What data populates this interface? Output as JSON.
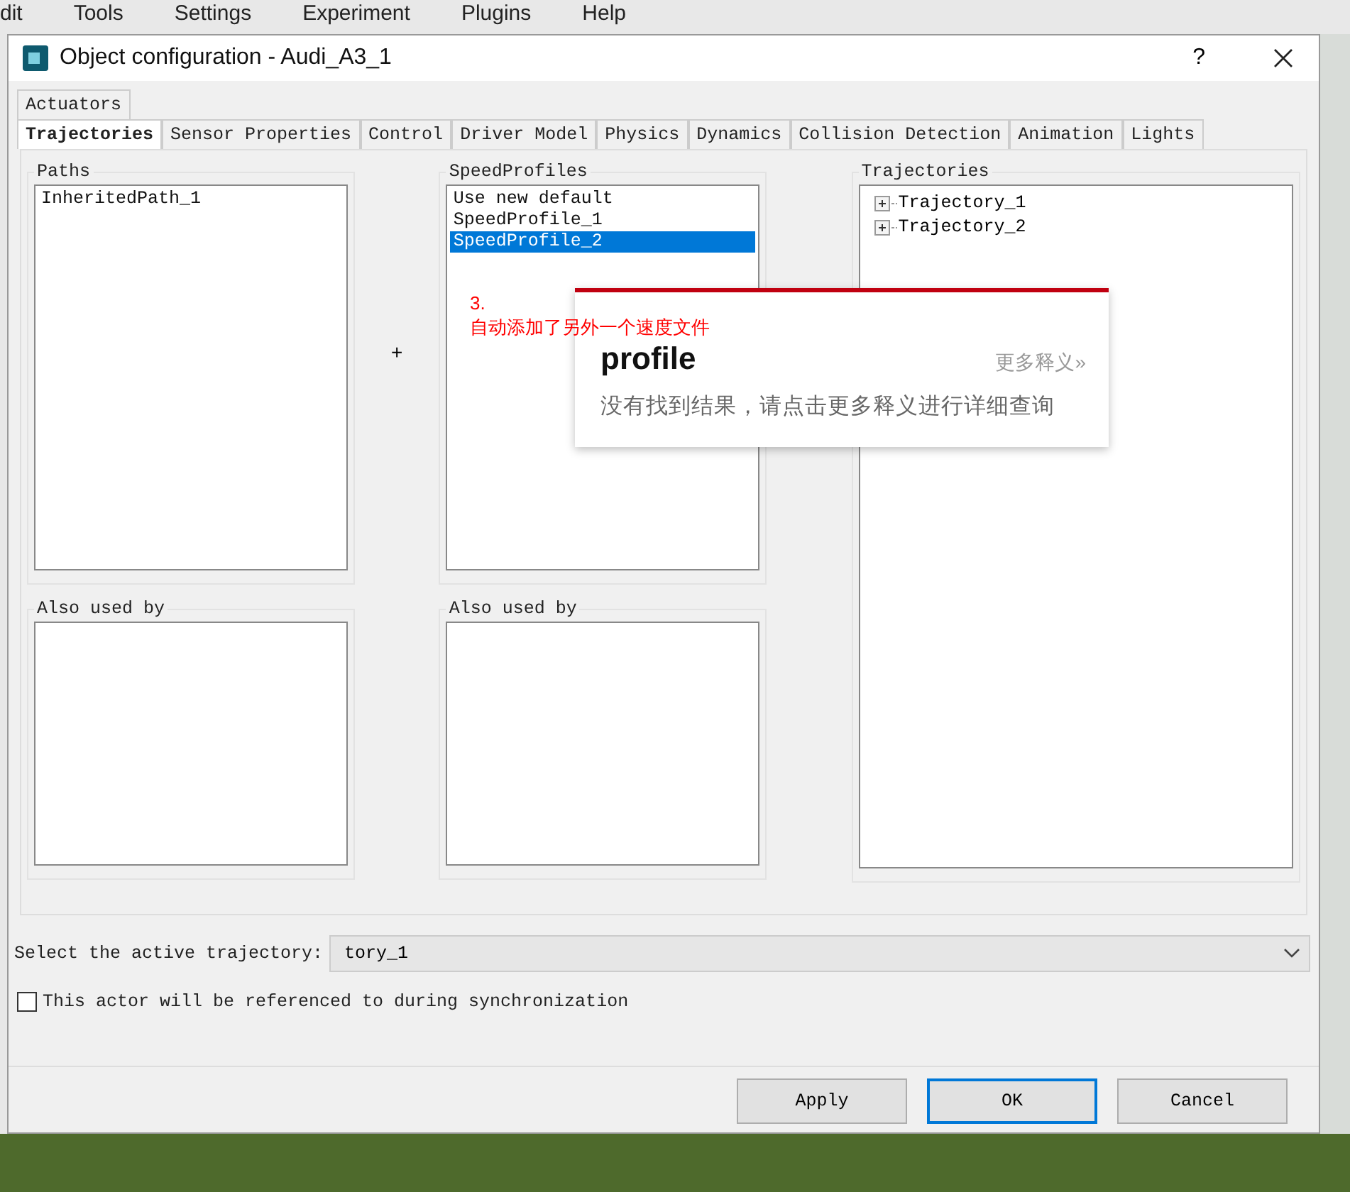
{
  "menu_bar": [
    "dit",
    "Tools",
    "Settings",
    "Experiment",
    "Plugins",
    "Help"
  ],
  "window": {
    "title": "Object configuration - Audi_A3_1",
    "help": "?"
  },
  "tab_rows": [
    [
      {
        "label": "Actuators",
        "selected": false
      }
    ],
    [
      {
        "label": "Trajectories",
        "selected": true
      },
      {
        "label": "Sensor Properties",
        "selected": false
      },
      {
        "label": "Control",
        "selected": false
      },
      {
        "label": "Driver Model",
        "selected": false
      },
      {
        "label": "Physics",
        "selected": false
      },
      {
        "label": "Dynamics",
        "selected": false
      },
      {
        "label": "Collision Detection",
        "selected": false
      },
      {
        "label": "Animation",
        "selected": false
      },
      {
        "label": "Lights",
        "selected": false
      }
    ]
  ],
  "paths": {
    "title": "Paths",
    "items": [
      {
        "label": "InheritedPath_1",
        "selected": false
      }
    ]
  },
  "add_button": "+",
  "speed_profiles": {
    "title": "SpeedProfiles",
    "items": [
      {
        "label": "Use new default",
        "selected": false
      },
      {
        "label": "SpeedProfile_1",
        "selected": false
      },
      {
        "label": "SpeedProfile_2",
        "selected": true
      }
    ]
  },
  "trajectories": {
    "title": "Trajectories",
    "items": [
      {
        "label": "Trajectory_1",
        "expanded": false
      },
      {
        "label": "Trajectory_2",
        "expanded": false
      }
    ]
  },
  "paths_used_by": {
    "title": "Also used by"
  },
  "speed_used_by": {
    "title": "Also used by"
  },
  "active_trajectory": {
    "label": "Select the active trajectory:",
    "value": "tory_1"
  },
  "sync_checkbox": {
    "label": "This actor will be referenced to during synchronization",
    "checked": false
  },
  "buttons": [
    {
      "label": "Apply",
      "default": false
    },
    {
      "label": "OK",
      "default": true
    },
    {
      "label": "Cancel",
      "default": false
    }
  ],
  "dictionary_popup": {
    "word": "profile",
    "more": "更多释义»",
    "message": "没有找到结果，请点击更多释义进行详细查询"
  },
  "annotation": {
    "lines": [
      "3.",
      "自动添加了另外一个速度文件"
    ]
  }
}
